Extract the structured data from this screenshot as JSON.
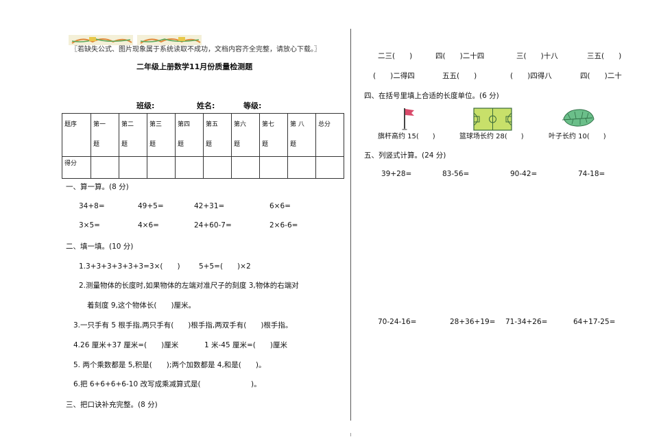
{
  "notice": "〖若缺失公式、图片现象属于系统读取不成功，文档内容齐全完整，请放心下载。〗",
  "title": "二年级上册数学11月份质量检测题",
  "info": {
    "class_label": "班级:",
    "name_label": "姓名:",
    "grade_label": "等级:"
  },
  "score_table": {
    "row1_label": "题序",
    "columns": [
      {
        "top": "第一",
        "bottom": "题"
      },
      {
        "top": "第二",
        "bottom": "题"
      },
      {
        "top": "第三",
        "bottom": "题"
      },
      {
        "top": "第四",
        "bottom": "题"
      },
      {
        "top": "第五",
        "bottom": "题"
      },
      {
        "top": "第六",
        "bottom": "题"
      },
      {
        "top": "第七",
        "bottom": "题"
      },
      {
        "top": "第 八",
        "bottom": "题"
      }
    ],
    "total_label": "总分",
    "row2_label": "得分"
  },
  "section1": {
    "heading": "一、算一算。(8 分)",
    "row1": [
      "34+8=",
      "49+5=",
      "42+31=",
      "6×6="
    ],
    "row2": [
      "3×5=",
      "4×6=",
      "24+60-7=",
      "2×6-6="
    ]
  },
  "section2": {
    "heading": "二、填一填。(10 分)",
    "q1a": "1.3+3+3+3+3+3=3×(　　)",
    "q1b": "5+5=(　　)×2",
    "q2a": "2.测量物体的长度时,如果物体的左端对准尺子的刻度 3,物体的右端对",
    "q2b": "着刻度 9,这个物体长(　　)厘米。",
    "q3": "3.一只手有 5 根手指,两只手有(　　)根手指,两双手有(　　)根手指。",
    "q4a": "4.26 厘米+37 厘米=(　　)厘米",
    "q4b": "1 米-45 厘米=(　　)厘米",
    "q5": "5. 两个乘数都是 5,积是(　　);两个加数都是 4,和是(　　)。",
    "q6": "6.把 6+6+6+6-10 改写成乘减算式是(　　　　　　　)。"
  },
  "section3": {
    "heading": "三、把口诀补充完整。(8 分)",
    "row1": [
      "二三(　　)",
      "四(　　)二十四",
      "三(　　)十八",
      "三五(　　)"
    ],
    "row2": [
      "(　　)二得四",
      "五五(　　)",
      "(　　)四得八",
      "四(　　)二十"
    ]
  },
  "section4": {
    "heading": "四、在括号里填上合适的长度单位。(6 分)",
    "items": [
      "旗杆高约 15(　　)",
      "篮球场长约 28(　　)",
      "叶子长约 10(　　)"
    ],
    "icons": [
      "flag-icon",
      "basketball-court-icon",
      "leaf-icon"
    ]
  },
  "section5": {
    "heading": "五、列竖式计算。(24 分)",
    "row1": [
      "39+28=",
      "83-56=",
      "90-42=",
      "74-18="
    ],
    "row2": [
      "70-24-16=",
      "28+36+19=",
      "71-34+26=",
      "64+17-25="
    ]
  },
  "colors": {
    "flag": "#d94a6a",
    "court": "#c8e06a",
    "leaf": "#6bbf8a"
  }
}
